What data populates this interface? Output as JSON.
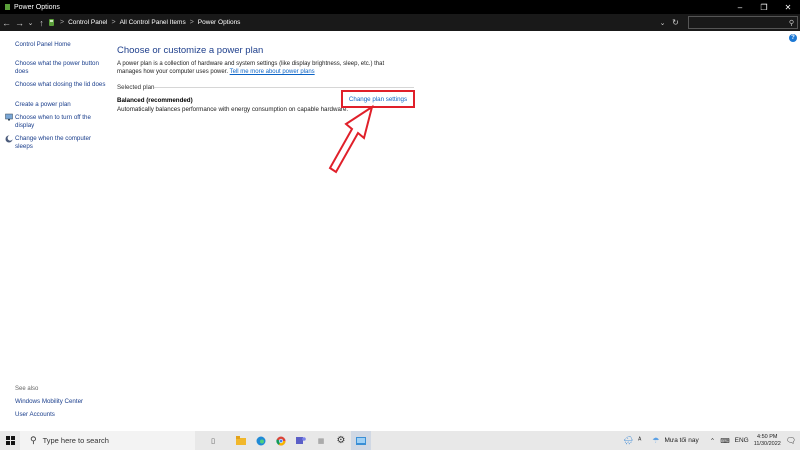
{
  "window": {
    "title": "Power Options",
    "controls": {
      "minimize": "–",
      "maximize": "❐",
      "close": "✕"
    }
  },
  "address_bar": {
    "breadcrumbs": [
      "Control Panel",
      "All Control Panel Items",
      "Power Options"
    ],
    "separator": ">",
    "search_placeholder": ""
  },
  "left_pane": {
    "home": "Control Panel Home",
    "links": [
      "Choose what the power button does",
      "Choose what closing the lid does",
      "Create a power plan",
      "Choose when to turn off the display",
      "Change when the computer sleeps"
    ],
    "see_also": {
      "heading": "See also",
      "links": [
        "Windows Mobility Center",
        "User Accounts"
      ]
    }
  },
  "main": {
    "heading": "Choose or customize a power plan",
    "intro_text": "A power plan is a collection of hardware and system settings (like display brightness, sleep, etc.) that manages how your computer uses power.",
    "intro_link": "Tell me more about power plans",
    "selected_plan_label": "Selected plan",
    "plan_name": "Balanced (recommended)",
    "plan_description": "Automatically balances performance with energy consumption on capable hardware.",
    "change_link": "Change plan settings",
    "help_glyph": "?"
  },
  "taskbar": {
    "search_placeholder": "Type here to search",
    "weather": "Mưa tối nay",
    "language": "ENG",
    "time": "4:50 PM",
    "date": "11/30/2022"
  },
  "colors": {
    "link": "#1a3e8c",
    "accent_link": "#0b63c5",
    "highlight_red": "#e0202a"
  }
}
